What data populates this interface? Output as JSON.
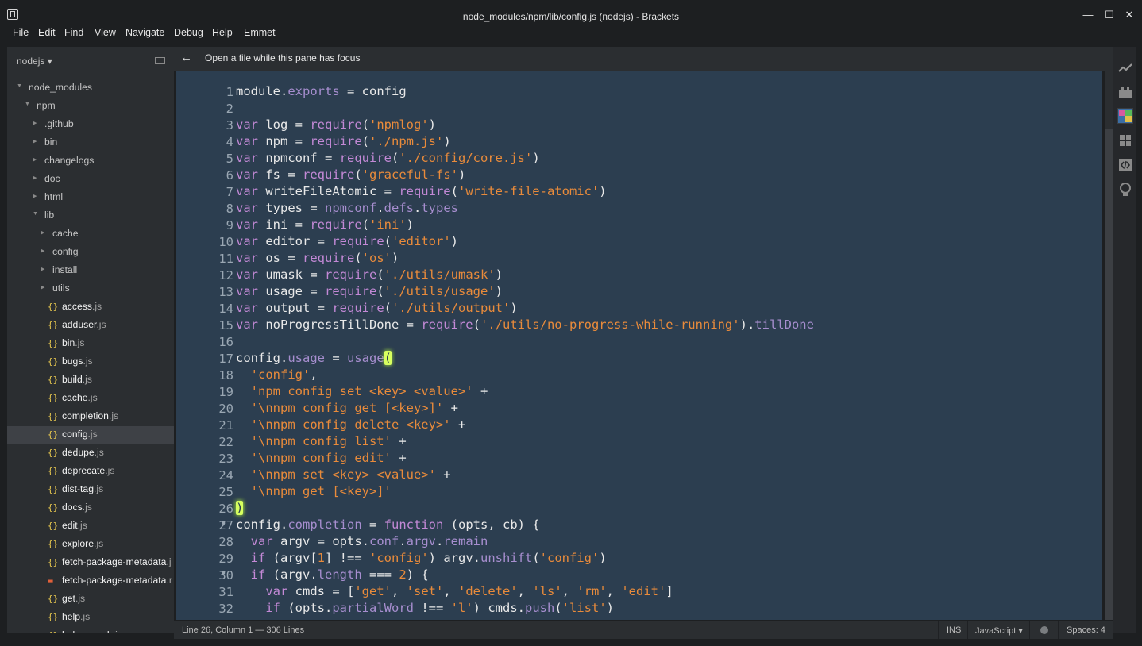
{
  "window": {
    "title": "node_modules/npm/lib/config.js (nodejs) - Brackets",
    "controls": {
      "minimize": "—",
      "maximize": "☐",
      "close": "✕"
    }
  },
  "menu": [
    "File",
    "Edit",
    "Find",
    "View",
    "Navigate",
    "Debug",
    "Help",
    "Emmet"
  ],
  "sidebar": {
    "project": "nodejs ▾",
    "tree": [
      {
        "label": "node_modules",
        "level": 0,
        "type": "folder",
        "open": true
      },
      {
        "label": "npm",
        "level": 1,
        "type": "folder",
        "open": true
      },
      {
        "label": ".github",
        "level": 2,
        "type": "folder",
        "open": false
      },
      {
        "label": "bin",
        "level": 2,
        "type": "folder",
        "open": false
      },
      {
        "label": "changelogs",
        "level": 2,
        "type": "folder",
        "open": false
      },
      {
        "label": "doc",
        "level": 2,
        "type": "folder",
        "open": false
      },
      {
        "label": "html",
        "level": 2,
        "type": "folder",
        "open": false
      },
      {
        "label": "lib",
        "level": 2,
        "type": "folder",
        "open": true
      },
      {
        "label": "cache",
        "level": 3,
        "type": "folder",
        "open": false
      },
      {
        "label": "config",
        "level": 3,
        "type": "folder",
        "open": false
      },
      {
        "label": "install",
        "level": 3,
        "type": "folder",
        "open": false
      },
      {
        "label": "utils",
        "level": 3,
        "type": "folder",
        "open": false
      },
      {
        "name": "access",
        "ext": ".js",
        "level": 3,
        "type": "file"
      },
      {
        "name": "adduser",
        "ext": ".js",
        "level": 3,
        "type": "file"
      },
      {
        "name": "bin",
        "ext": ".js",
        "level": 3,
        "type": "file"
      },
      {
        "name": "bugs",
        "ext": ".js",
        "level": 3,
        "type": "file"
      },
      {
        "name": "build",
        "ext": ".js",
        "level": 3,
        "type": "file"
      },
      {
        "name": "cache",
        "ext": ".js",
        "level": 3,
        "type": "file"
      },
      {
        "name": "completion",
        "ext": ".js",
        "level": 3,
        "type": "file"
      },
      {
        "name": "config",
        "ext": ".js",
        "level": 3,
        "type": "file",
        "selected": true
      },
      {
        "name": "dedupe",
        "ext": ".js",
        "level": 3,
        "type": "file"
      },
      {
        "name": "deprecate",
        "ext": ".js",
        "level": 3,
        "type": "file"
      },
      {
        "name": "dist-tag",
        "ext": ".js",
        "level": 3,
        "type": "file"
      },
      {
        "name": "docs",
        "ext": ".js",
        "level": 3,
        "type": "file"
      },
      {
        "name": "edit",
        "ext": ".js",
        "level": 3,
        "type": "file"
      },
      {
        "name": "explore",
        "ext": ".js",
        "level": 3,
        "type": "file"
      },
      {
        "name": "fetch-package-metadata",
        "ext": ".j",
        "level": 3,
        "type": "file"
      },
      {
        "name": "fetch-package-metadata",
        "ext": ".r",
        "level": 3,
        "type": "file",
        "icon": "red"
      },
      {
        "name": "get",
        "ext": ".js",
        "level": 3,
        "type": "file"
      },
      {
        "name": "help",
        "ext": ".js",
        "level": 3,
        "type": "file"
      },
      {
        "name": "help-search",
        "ext": ".js",
        "level": 3,
        "type": "file"
      }
    ]
  },
  "pane": {
    "back_arrow": "←",
    "hint": "Open a file while this pane has focus"
  },
  "editor": {
    "language": "JavaScript",
    "lines": [
      [
        [
          "module",
          "t"
        ],
        [
          ".",
          "t"
        ],
        [
          "exports",
          "p"
        ],
        [
          " = config",
          "t"
        ]
      ],
      [],
      [
        [
          "var",
          "k"
        ],
        [
          " log = ",
          "t"
        ],
        [
          "require",
          "k"
        ],
        [
          "(",
          "t"
        ],
        [
          "'npmlog'",
          "s"
        ],
        [
          ")",
          "t"
        ]
      ],
      [
        [
          "var",
          "k"
        ],
        [
          " npm = ",
          "t"
        ],
        [
          "require",
          "k"
        ],
        [
          "(",
          "t"
        ],
        [
          "'./npm.js'",
          "s"
        ],
        [
          ")",
          "t"
        ]
      ],
      [
        [
          "var",
          "k"
        ],
        [
          " npmconf = ",
          "t"
        ],
        [
          "require",
          "k"
        ],
        [
          "(",
          "t"
        ],
        [
          "'./config/core.js'",
          "s"
        ],
        [
          ")",
          "t"
        ]
      ],
      [
        [
          "var",
          "k"
        ],
        [
          " fs = ",
          "t"
        ],
        [
          "require",
          "k"
        ],
        [
          "(",
          "t"
        ],
        [
          "'graceful-fs'",
          "s"
        ],
        [
          ")",
          "t"
        ]
      ],
      [
        [
          "var",
          "k"
        ],
        [
          " writeFileAtomic = ",
          "t"
        ],
        [
          "require",
          "k"
        ],
        [
          "(",
          "t"
        ],
        [
          "'write-file-atomic'",
          "s"
        ],
        [
          ")",
          "t"
        ]
      ],
      [
        [
          "var",
          "k"
        ],
        [
          " types = ",
          "t"
        ],
        [
          "npmconf",
          "p"
        ],
        [
          ".",
          "t"
        ],
        [
          "defs",
          "p"
        ],
        [
          ".",
          "t"
        ],
        [
          "types",
          "p"
        ]
      ],
      [
        [
          "var",
          "k"
        ],
        [
          " ini = ",
          "t"
        ],
        [
          "require",
          "k"
        ],
        [
          "(",
          "t"
        ],
        [
          "'ini'",
          "s"
        ],
        [
          ")",
          "t"
        ]
      ],
      [
        [
          "var",
          "k"
        ],
        [
          " editor = ",
          "t"
        ],
        [
          "require",
          "k"
        ],
        [
          "(",
          "t"
        ],
        [
          "'editor'",
          "s"
        ],
        [
          ")",
          "t"
        ]
      ],
      [
        [
          "var",
          "k"
        ],
        [
          " os = ",
          "t"
        ],
        [
          "require",
          "k"
        ],
        [
          "(",
          "t"
        ],
        [
          "'os'",
          "s"
        ],
        [
          ")",
          "t"
        ]
      ],
      [
        [
          "var",
          "k"
        ],
        [
          " umask = ",
          "t"
        ],
        [
          "require",
          "k"
        ],
        [
          "(",
          "t"
        ],
        [
          "'./utils/umask'",
          "s"
        ],
        [
          ")",
          "t"
        ]
      ],
      [
        [
          "var",
          "k"
        ],
        [
          " usage = ",
          "t"
        ],
        [
          "require",
          "k"
        ],
        [
          "(",
          "t"
        ],
        [
          "'./utils/usage'",
          "s"
        ],
        [
          ")",
          "t"
        ]
      ],
      [
        [
          "var",
          "k"
        ],
        [
          " output = ",
          "t"
        ],
        [
          "require",
          "k"
        ],
        [
          "(",
          "t"
        ],
        [
          "'./utils/output'",
          "s"
        ],
        [
          ")",
          "t"
        ]
      ],
      [
        [
          "var",
          "k"
        ],
        [
          " noProgressTillDone = ",
          "t"
        ],
        [
          "require",
          "k"
        ],
        [
          "(",
          "t"
        ],
        [
          "'./utils/no-progress-while-running'",
          "s"
        ],
        [
          ").",
          "t"
        ],
        [
          "tillDone",
          "p"
        ]
      ],
      [],
      [
        [
          "config",
          "t"
        ],
        [
          ".",
          "t"
        ],
        [
          "usage",
          "p"
        ],
        [
          " = ",
          "t"
        ],
        [
          "usage",
          "p"
        ],
        [
          "(",
          "m"
        ]
      ],
      [
        [
          "  ",
          "t"
        ],
        [
          "'config'",
          "s"
        ],
        [
          ",",
          "t"
        ]
      ],
      [
        [
          "  ",
          "t"
        ],
        [
          "'npm config set <key> <value>'",
          "s"
        ],
        [
          " +",
          "t"
        ]
      ],
      [
        [
          "  ",
          "t"
        ],
        [
          "'\\nnpm config get [<key>]'",
          "s"
        ],
        [
          " +",
          "t"
        ]
      ],
      [
        [
          "  ",
          "t"
        ],
        [
          "'\\nnpm config delete <key>'",
          "s"
        ],
        [
          " +",
          "t"
        ]
      ],
      [
        [
          "  ",
          "t"
        ],
        [
          "'\\nnpm config list'",
          "s"
        ],
        [
          " +",
          "t"
        ]
      ],
      [
        [
          "  ",
          "t"
        ],
        [
          "'\\nnpm config edit'",
          "s"
        ],
        [
          " +",
          "t"
        ]
      ],
      [
        [
          "  ",
          "t"
        ],
        [
          "'\\nnpm set <key> <value>'",
          "s"
        ],
        [
          " +",
          "t"
        ]
      ],
      [
        [
          "  ",
          "t"
        ],
        [
          "'\\nnpm get [<key>]'",
          "s"
        ]
      ],
      [
        [
          ")",
          "m"
        ]
      ],
      [
        [
          "config",
          "t"
        ],
        [
          ".",
          "t"
        ],
        [
          "completion",
          "p"
        ],
        [
          " = ",
          "t"
        ],
        [
          "function",
          "k"
        ],
        [
          " (opts, cb) {",
          "t"
        ]
      ],
      [
        [
          "  ",
          "t"
        ],
        [
          "var",
          "k"
        ],
        [
          " argv = opts.",
          "t"
        ],
        [
          "conf",
          "p"
        ],
        [
          ".",
          "t"
        ],
        [
          "argv",
          "p"
        ],
        [
          ".",
          "t"
        ],
        [
          "remain",
          "p"
        ]
      ],
      [
        [
          "  ",
          "t"
        ],
        [
          "if",
          "k"
        ],
        [
          " (argv[",
          "t"
        ],
        [
          "1",
          "n"
        ],
        [
          "] !== ",
          "t"
        ],
        [
          "'config'",
          "s"
        ],
        [
          ") argv.",
          "t"
        ],
        [
          "unshift",
          "p"
        ],
        [
          "(",
          "t"
        ],
        [
          "'config'",
          "s"
        ],
        [
          ")",
          "t"
        ]
      ],
      [
        [
          "  ",
          "t"
        ],
        [
          "if",
          "k"
        ],
        [
          " (argv.",
          "t"
        ],
        [
          "length",
          "p"
        ],
        [
          " === ",
          "t"
        ],
        [
          "2",
          "n"
        ],
        [
          ") {",
          "t"
        ]
      ],
      [
        [
          "    ",
          "t"
        ],
        [
          "var",
          "k"
        ],
        [
          " cmds = [",
          "t"
        ],
        [
          "'get'",
          "s"
        ],
        [
          ", ",
          "t"
        ],
        [
          "'set'",
          "s"
        ],
        [
          ", ",
          "t"
        ],
        [
          "'delete'",
          "s"
        ],
        [
          ", ",
          "t"
        ],
        [
          "'ls'",
          "s"
        ],
        [
          ", ",
          "t"
        ],
        [
          "'rm'",
          "s"
        ],
        [
          ", ",
          "t"
        ],
        [
          "'edit'",
          "s"
        ],
        [
          "]",
          "t"
        ]
      ],
      [
        [
          "    ",
          "t"
        ],
        [
          "if",
          "k"
        ],
        [
          " (opts.",
          "t"
        ],
        [
          "partialWord",
          "p"
        ],
        [
          " !== ",
          "t"
        ],
        [
          "'l'",
          "s"
        ],
        [
          ") cmds.",
          "t"
        ],
        [
          "push",
          "p"
        ],
        [
          "(",
          "t"
        ],
        [
          "'list'",
          "s"
        ],
        [
          ")",
          "t"
        ]
      ]
    ],
    "fold_lines": [
      27,
      30
    ],
    "fold_marker": "▼"
  },
  "status": {
    "cursor": "Line 26, Column 1 — 306 Lines",
    "mode": "INS",
    "language": "JavaScript ▾",
    "spaces": "Spaces: 4"
  },
  "toolbar_icons": [
    "live-preview-icon",
    "extension-manager-icon",
    "theme-icon",
    "grid-icon",
    "code-icon",
    "bulb-icon"
  ],
  "colors": {
    "editor_bg": "#2c3e50",
    "keyword": "#c389d6",
    "string": "#e98b3b",
    "property": "#a78ecf",
    "bracket_match": "#d7ff5f",
    "sidebar_bg": "#2b2e31"
  }
}
